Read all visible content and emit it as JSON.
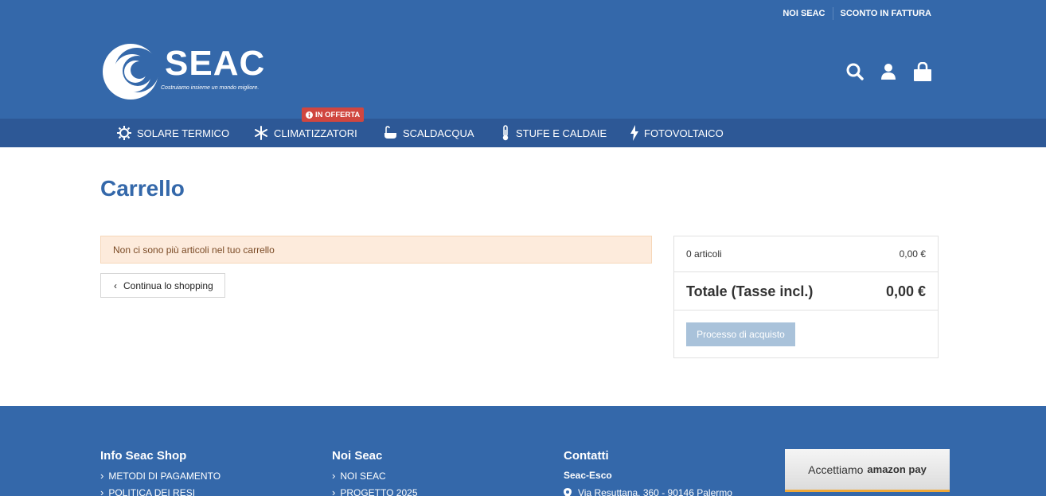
{
  "header": {
    "top_links": [
      "NOI SEAC",
      "SCONTO IN FATTURA"
    ],
    "logo": {
      "name": "SEAC",
      "tagline": "Costruiamo insieme un mondo migliore."
    },
    "icons": [
      "search-icon",
      "user-icon",
      "shopping-bag-icon"
    ],
    "bg_color": "#3468aa"
  },
  "nav": {
    "badge": "IN OFFERTA",
    "items": [
      {
        "label": "SOLARE TERMICO",
        "icon": "sun-icon"
      },
      {
        "label": "CLIMATIZZATORI",
        "icon": "snowflake-icon"
      },
      {
        "label": "SCALDACQUA",
        "icon": "bathtub-icon"
      },
      {
        "label": "STUFE E CALDAIE",
        "icon": "thermometer-icon"
      },
      {
        "label": "FOTOVOLTAICO",
        "icon": "lightning-icon"
      }
    ]
  },
  "cart": {
    "title": "Carrello",
    "empty_message": "Non ci sono più articoli nel tuo carrello",
    "continue_label": "Continua lo shopping",
    "summary": {
      "items_label": "0 articoli",
      "items_value": "0,00 €",
      "total_label": "Totale (Tasse incl.)",
      "total_value": "0,00 €",
      "checkout_label": "Processo di acquisto"
    }
  },
  "footer": {
    "col1": {
      "title": "Info Seac Shop",
      "links": [
        "METODI DI PAGAMENTO",
        "POLITICA DEI RESI"
      ]
    },
    "col2": {
      "title": "Noi Seac",
      "links": [
        "NOI SEAC",
        "PROGETTO 2025"
      ]
    },
    "col3": {
      "title": "Contatti",
      "company": "Seac-Esco",
      "address": "Via Resuttana, 360 - 90146 Palermo"
    },
    "amazon": {
      "text": "Accettiamo",
      "brand": "amazon pay"
    }
  }
}
